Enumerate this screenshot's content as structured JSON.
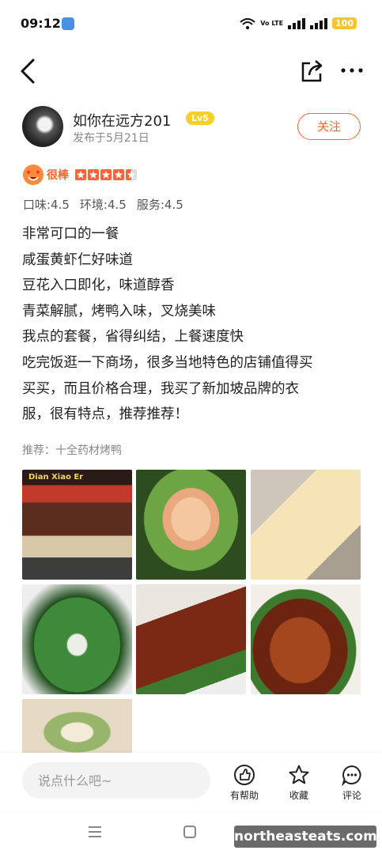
{
  "status_bar": {
    "time": "09:12",
    "network": "Vo LTE",
    "battery": "100"
  },
  "user": {
    "name": "如你在远方201",
    "level": "Lv5",
    "date": "发布于5月21日",
    "follow_label": "关注"
  },
  "rating": {
    "label": "很棒",
    "stars": 4.5,
    "sub_scores": [
      "口味:4.5",
      "环境:4.5",
      "服务:4.5"
    ]
  },
  "review": {
    "lines": [
      "非常可口的一餐",
      "咸蛋黄虾仁好味道",
      "豆花入口即化，味道醇香",
      "青菜解腻，烤鸭入味，叉烧美味",
      "我点的套餐，省得纠结，上餐速度快",
      "吃完饭逛一下商场，很多当地特色的店铺值得买",
      "买买，而且价格合理，我买了新加坡品牌的衣",
      "服，很有特点，推荐推荐！"
    ],
    "recommend": "推荐：十全药材烤鸭"
  },
  "photo_sign": "Dian Xiao Er",
  "bottom_bar": {
    "comment_placeholder": "说点什么吧~",
    "helpful_label": "有帮助",
    "collect_label": "收藏",
    "comment_label": "评论"
  },
  "watermark": "northeasteats.com",
  "colors": {
    "accent": "#ff6633",
    "level_badge": "#f6cf2c"
  }
}
